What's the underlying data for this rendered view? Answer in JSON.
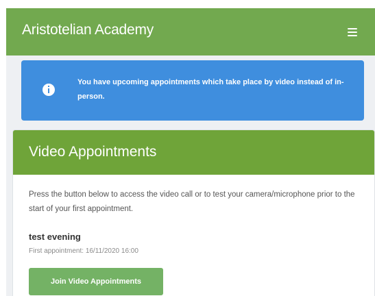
{
  "navbar": {
    "brand": "Aristotelian Academy",
    "menu_icon": "hamburger-menu-icon",
    "background": "#72a94f"
  },
  "alert": {
    "icon": "info-icon",
    "message": "You have upcoming appointments which take place by video instead of in-person.",
    "background": "#3f8ede"
  },
  "video_card": {
    "title": "Video Appointments",
    "header_background": "#6fa439",
    "description": "Press the button below to access the video call or to test your camera/microphone prior to the start of your first appointment.",
    "appointment": {
      "name": "test evening",
      "first_appointment": "First appointment: 16/11/2020 16:00"
    },
    "join_button_label": "Join Video Appointments",
    "button_background": "#74b265"
  }
}
